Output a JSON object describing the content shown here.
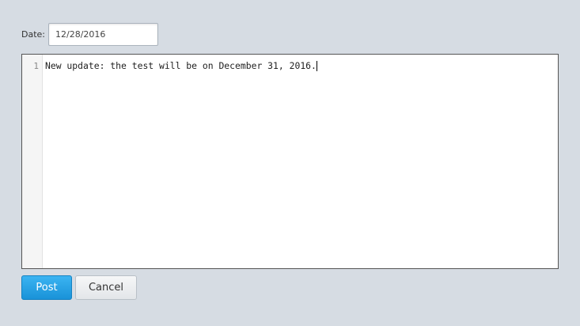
{
  "form": {
    "date_label": "Date:",
    "date_value": "12/28/2016"
  },
  "editor": {
    "line_numbers": [
      "1"
    ],
    "lines": [
      "New update: the test will be on December 31, 2016."
    ]
  },
  "actions": {
    "post_label": "Post",
    "cancel_label": "Cancel"
  },
  "colors": {
    "background": "#d6dce3",
    "primary_button": "#1992d8"
  }
}
